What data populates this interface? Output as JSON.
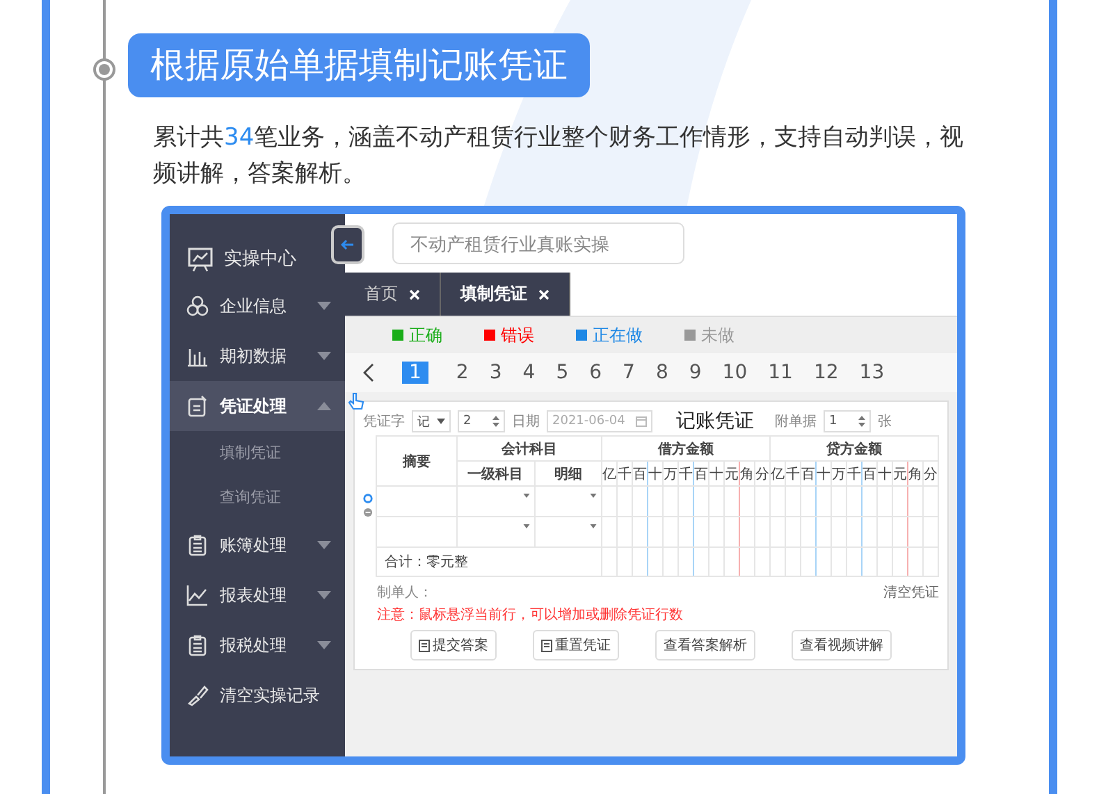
{
  "heading": "根据原始单据填制记账凭证",
  "description": [
    {
      "text": "累计共",
      "highlight": false
    },
    {
      "text": "34",
      "highlight": true
    },
    {
      "text": "笔业务，涵盖不动产租赁行业整个财务工作情形，支持自动判误，视频讲解，答案解析。",
      "highlight": false
    }
  ],
  "app": {
    "sidebar": {
      "title": "实操中心",
      "items": [
        {
          "label": "企业信息",
          "kind": "menu",
          "expanded": false,
          "selected": false
        },
        {
          "label": "期初数据",
          "kind": "menu",
          "expanded": false,
          "selected": false
        },
        {
          "label": "凭证处理",
          "kind": "menu",
          "expanded": true,
          "selected": true,
          "children": [
            {
              "label": "填制凭证"
            },
            {
              "label": "查询凭证"
            }
          ]
        },
        {
          "label": "账簿处理",
          "kind": "menu",
          "expanded": false,
          "selected": false
        },
        {
          "label": "报表处理",
          "kind": "menu",
          "expanded": false,
          "selected": false
        },
        {
          "label": "报税处理",
          "kind": "menu",
          "expanded": false,
          "selected": false
        },
        {
          "label": "清空实操记录",
          "kind": "action",
          "selected": false
        }
      ]
    },
    "search": {
      "placeholder": "不动产租赁行业真账实操"
    },
    "tabs": [
      {
        "label": "首页",
        "selected": false
      },
      {
        "label": "填制凭证",
        "selected": true
      }
    ],
    "legend": [
      {
        "label": "正确",
        "color": "#1aad19"
      },
      {
        "label": "错误",
        "color": "#ff0000"
      },
      {
        "label": "正在做",
        "color": "#1e88e5"
      },
      {
        "label": "未做",
        "color": "#999999"
      }
    ],
    "pages": [
      {
        "label": "1",
        "selected": true
      },
      {
        "label": "2",
        "selected": false
      },
      {
        "label": "3",
        "selected": false
      },
      {
        "label": "4",
        "selected": false
      },
      {
        "label": "5",
        "selected": false
      },
      {
        "label": "6",
        "selected": false
      },
      {
        "label": "7",
        "selected": false
      },
      {
        "label": "8",
        "selected": false
      },
      {
        "label": "9",
        "selected": false
      },
      {
        "label": "10",
        "selected": false
      },
      {
        "label": "11",
        "selected": false
      },
      {
        "label": "12",
        "selected": false
      },
      {
        "label": "13",
        "selected": false
      }
    ],
    "voucher": {
      "type_label": "凭证字",
      "type_value": "记",
      "number": "2",
      "date_label": "日期",
      "date": "2021-06-04",
      "title": "记账凭证",
      "attach_label": "附单据",
      "attach_value": "1",
      "attach_unit": "张",
      "columns": {
        "summary": "摘要",
        "account": "会计科目",
        "level1": "一级科目",
        "detail": "明细",
        "debit": "借方金额",
        "credit": "贷方金额"
      },
      "debit_digits": [
        "亿",
        "千",
        "百",
        "十",
        "万",
        "千",
        "百",
        "十",
        "元",
        "角",
        "分"
      ],
      "credit_digits": [
        "亿",
        "千",
        "百",
        "十",
        "万",
        "千",
        "百",
        "十",
        "元",
        "角",
        "分"
      ],
      "total": "合计：零元整",
      "preparer": "制单人：",
      "clear": "清空凭证",
      "note": "注意：鼠标悬浮当前行，可以增加或删除凭证行数",
      "buttons": [
        {
          "label": "提交答案",
          "kind": "icon"
        },
        {
          "label": "重置凭证",
          "kind": "icon"
        },
        {
          "label": "查看答案解析",
          "kind": "plain"
        },
        {
          "label": "查看视频讲解",
          "kind": "plain"
        }
      ]
    }
  }
}
